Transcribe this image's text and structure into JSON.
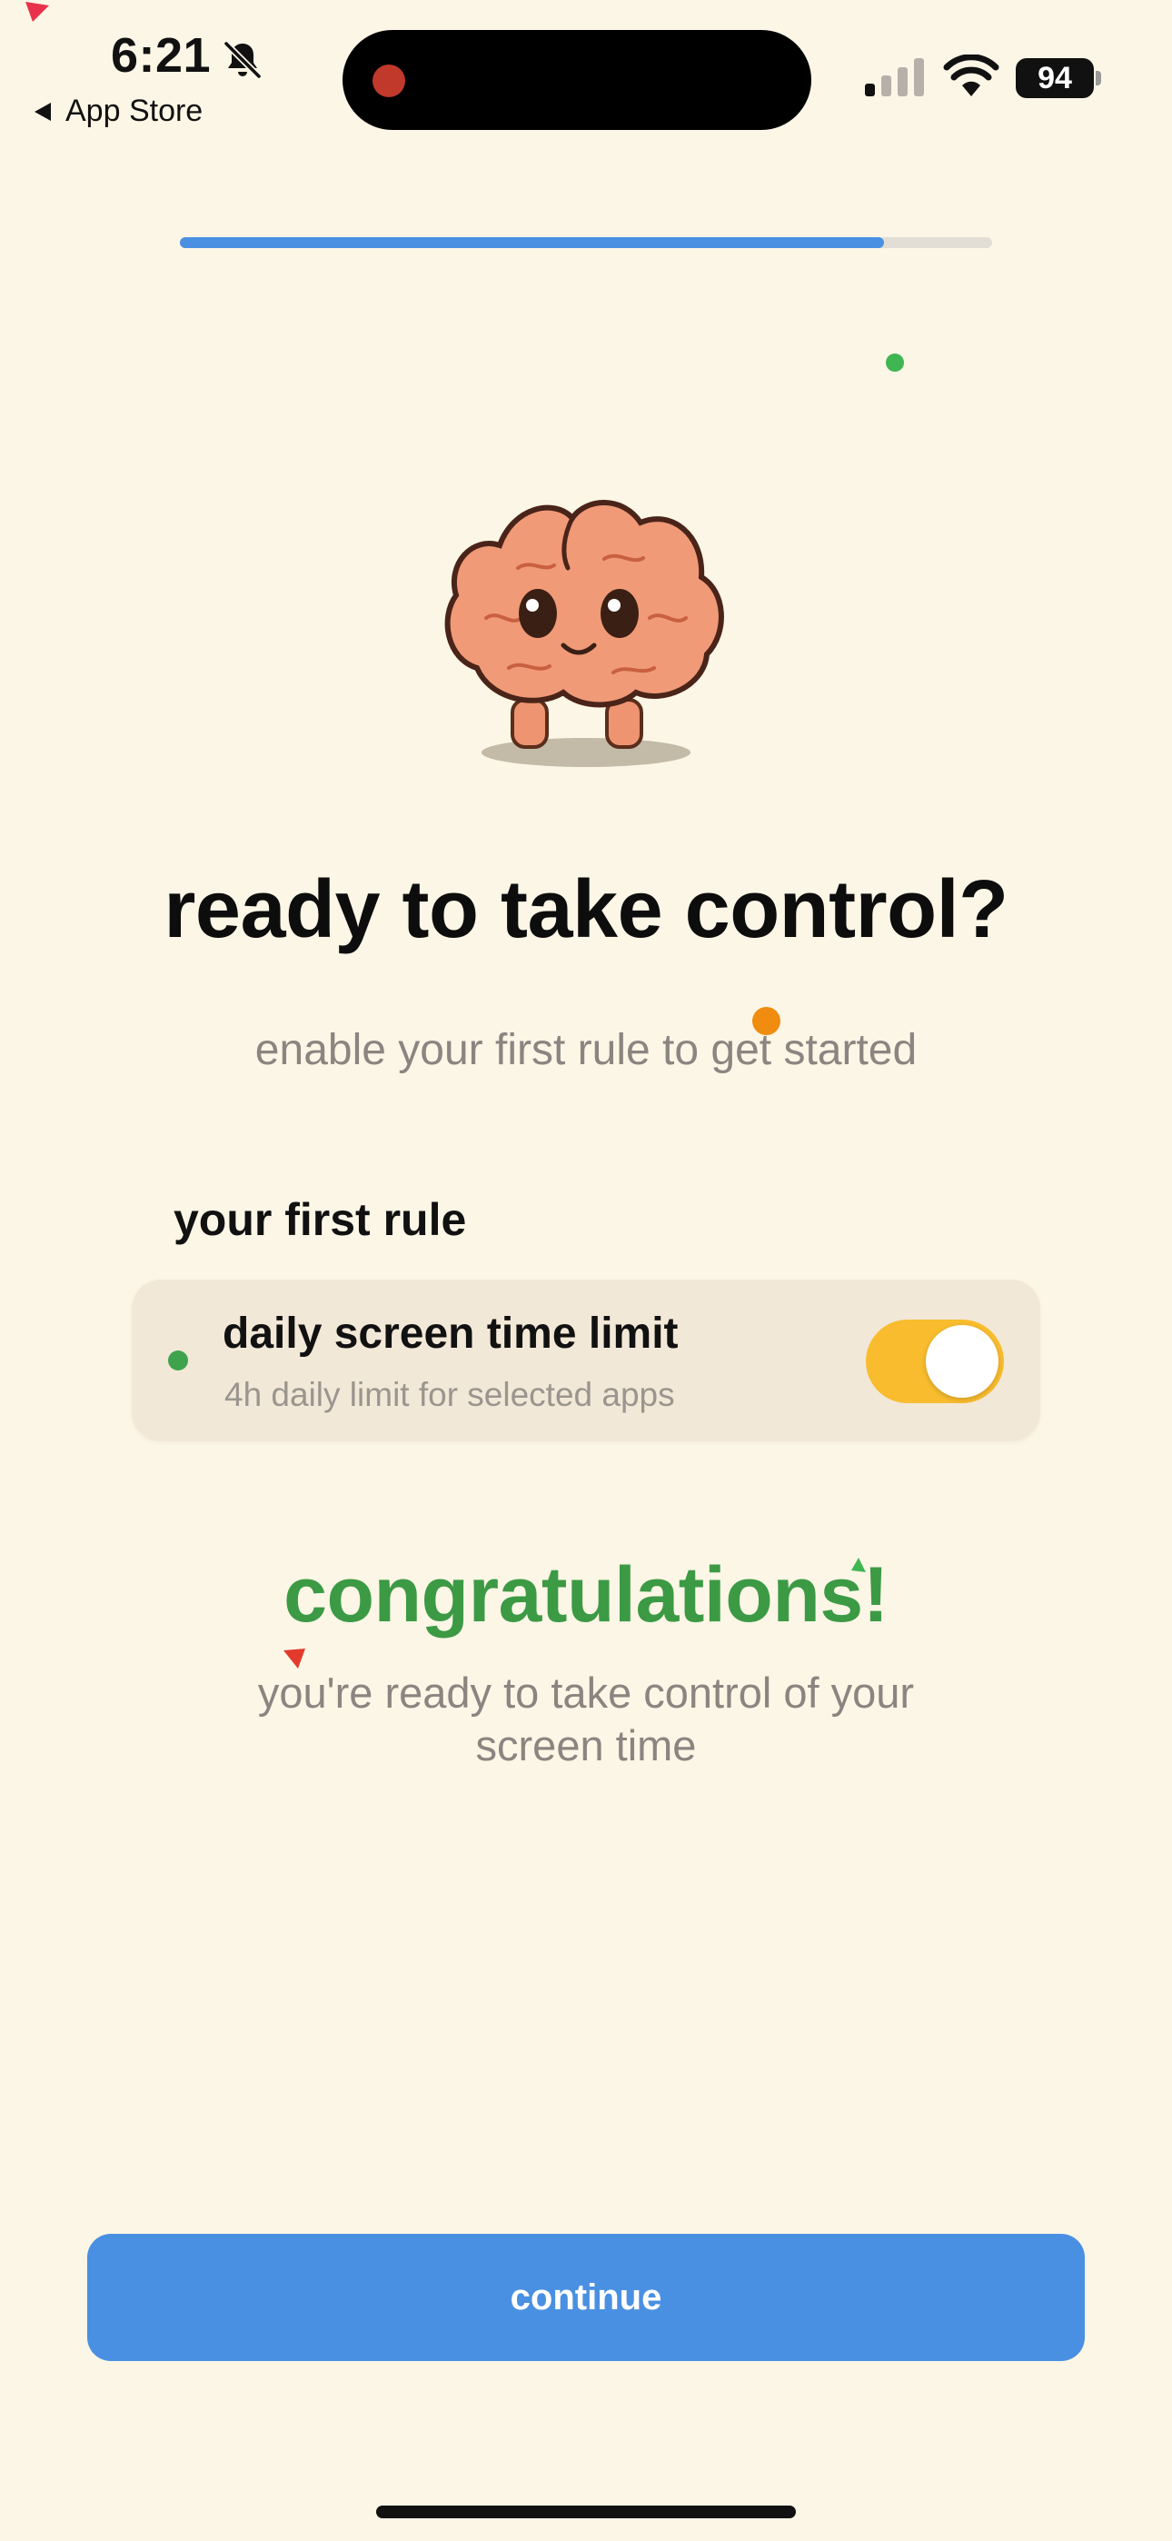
{
  "status_bar": {
    "time": "6:21",
    "back_label": "App Store",
    "battery_level": "94",
    "icons": [
      "bell-slash-icon",
      "signal-icon",
      "wifi-icon",
      "battery-icon"
    ]
  },
  "progress": {
    "fraction": 0.867,
    "color": "#4A90E2"
  },
  "onboarding": {
    "mascot": "brain-mascot-icon",
    "title": "ready to take control?",
    "subtitle": "enable your first rule to get started"
  },
  "rule_section": {
    "label": "your first rule",
    "rule": {
      "title": "daily screen time limit",
      "description": "4h daily limit for selected apps",
      "enabled": true,
      "toggle_color": "#F8BC2E"
    }
  },
  "result": {
    "heading": "congratulations!",
    "message": "you're ready to take control of your screen time"
  },
  "actions": {
    "continue_label": "continue"
  },
  "colors": {
    "background": "#FCF6E6",
    "accent_blue": "#4A90E2",
    "success_green": "#3C9A45",
    "muted_text": "#8a8580"
  }
}
